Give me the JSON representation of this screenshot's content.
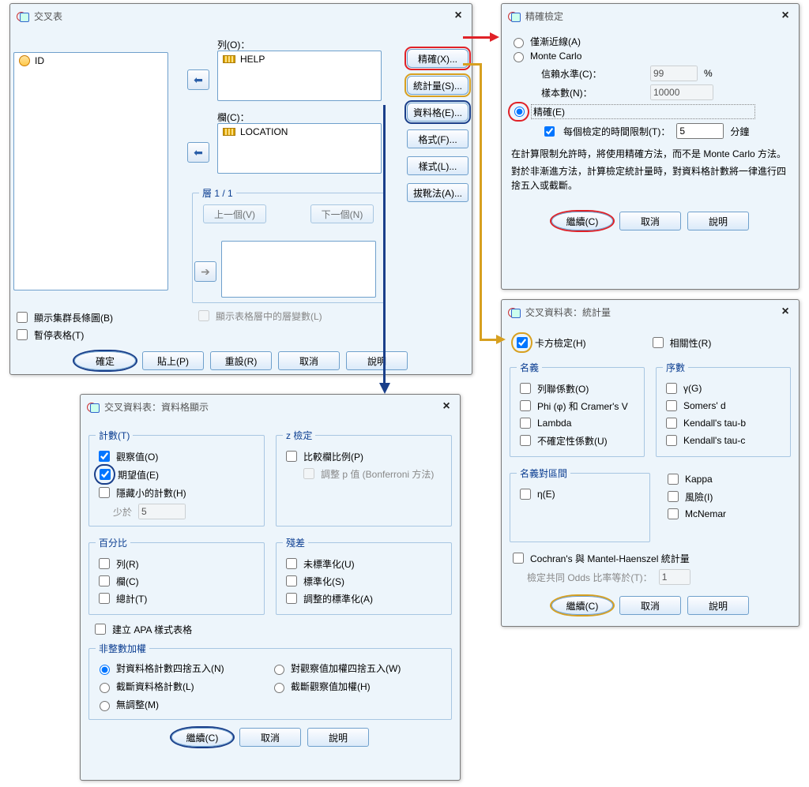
{
  "crosstabs": {
    "title": "交叉表",
    "vars": [
      "ID"
    ],
    "rows_label": "列(O)：",
    "rows_items": [
      "HELP"
    ],
    "cols_label": "欄(C)：",
    "cols_items": [
      "LOCATION"
    ],
    "layer_label": "層 1 / 1",
    "prev": "上一個(V)",
    "next": "下一個(N)",
    "show_layer_vars": "顯示表格層中的層變數(L)",
    "cluster_bar": "顯示集群長條圖(B)",
    "suppress": "暫停表格(T)",
    "ok": "確定",
    "paste": "貼上(P)",
    "reset": "重設(R)",
    "cancel": "取消",
    "help": "說明",
    "side": {
      "exact": "精確(X)...",
      "stats": "統計量(S)...",
      "cells": "資料格(E)...",
      "format": "格式(F)...",
      "style": "樣式(L)...",
      "boot": "拔靴法(A)..."
    }
  },
  "exact": {
    "title": "精確檢定",
    "asymptotic": "僅漸近線(A)",
    "monte": "Monte Carlo",
    "conf_label": "信賴水準(C)：",
    "conf_value": "99",
    "conf_pct": "%",
    "samples_label": "樣本數(N)：",
    "samples_value": "10000",
    "exact_opt": "精確(E)",
    "time_limit": "每個檢定的時間限制(T)：",
    "time_value": "5",
    "time_unit": "分鐘",
    "note1": "在計算限制允許時，將使用精確方法，而不是 Monte Carlo 方法。",
    "note2": "對於非漸進方法，計算檢定統計量時，對資料格計數將一律進行四捨五入或截斷。",
    "continue": "繼續(C)",
    "cancel": "取消",
    "help": "說明"
  },
  "stats": {
    "title": "交叉資料表：統計量",
    "chi": "卡方檢定(H)",
    "corr": "相關性(R)",
    "nominal_legend": "名義",
    "nominal": [
      "列聯係數(O)",
      "Phi (φ) 和 Cramer's V",
      "Lambda",
      "不確定性係數(U)"
    ],
    "ordinal_legend": "序數",
    "ordinal": [
      "γ(G)",
      "Somers' d",
      "Kendall's tau-b",
      "Kendall's tau-c"
    ],
    "interval_legend": "名義對區間",
    "interval": [
      "η(E)"
    ],
    "right2": [
      "Kappa",
      "風險(I)",
      "McNemar"
    ],
    "cochran": "Cochran's 與 Mantel-Haenszel 統計量",
    "odds_label": "檢定共同 Odds 比率等於(T)：",
    "odds_value": "1",
    "continue": "繼續(C)",
    "cancel": "取消",
    "help": "說明"
  },
  "cells": {
    "title": "交叉資料表：資料格顯示",
    "counts_legend": "計數(T)",
    "observed": "觀察值(O)",
    "expected": "期望值(E)",
    "hide_small": "隱藏小的計數(H)",
    "less_than": "少於",
    "less_than_value": "5",
    "z_legend": "z 檢定",
    "compare": "比較欄比例(P)",
    "bonf": "調整 p 值 (Bonferroni 方法)",
    "pct_legend": "百分比",
    "pct": [
      "列(R)",
      "欄(C)",
      "總計(T)"
    ],
    "apa": "建立 APA 樣式表格",
    "resid_legend": "殘差",
    "resid": [
      "未標準化(U)",
      "標準化(S)",
      "調整的標準化(A)"
    ],
    "weight_legend": "非整數加權",
    "w_round_cell": "對資料格計數四捨五入(N)",
    "w_round_case": "對觀察值加權四捨五入(W)",
    "w_trunc_cell": "截斷資料格計數(L)",
    "w_trunc_case": "截斷觀察值加權(H)",
    "w_none": "無調整(M)",
    "continue": "繼續(C)",
    "cancel": "取消",
    "help": "說明"
  }
}
